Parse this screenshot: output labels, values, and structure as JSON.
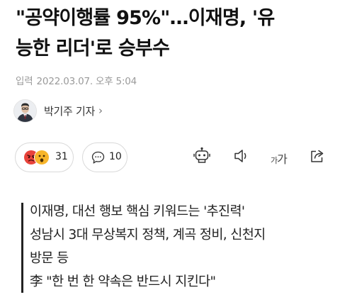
{
  "article": {
    "headline_line1": "\"공약이행률 95%\"…이재명, '유",
    "headline_line2": "능한 리더'로 승부수",
    "date_label": "입력",
    "date_value": "2022.03.07. 오후 5:04"
  },
  "reporter": {
    "name": "박기주 기자",
    "chevron": "›",
    "avatar_icon": "reporter-avatar"
  },
  "actions": {
    "reactions_count": "31",
    "reaction_icons": [
      "angry-face-icon",
      "surprised-face-icon"
    ],
    "comments_count": "10",
    "comment_icon": "speech-bubble-icon",
    "summary_bot_icon": "robot-icon",
    "tts_icon": "speaker-icon",
    "font_size_label_small": "가",
    "font_size_label_large": "가",
    "share_icon": "share-icon"
  },
  "summary": {
    "lines": [
      "이재명, 대선 행보 핵심 키워드는 '추진력'",
      "성남시 3대 무상복지 정책, 계곡 정비, 신천지",
      "방문 등",
      "李 \"한 번 한 약속은 반드시 지킨다\""
    ]
  },
  "colors": {
    "text": "#111111",
    "muted": "#9a9a9a",
    "border": "#d9d9d9",
    "angry_emoji": "#e8433b",
    "surprised_emoji": "#f7b52b"
  }
}
